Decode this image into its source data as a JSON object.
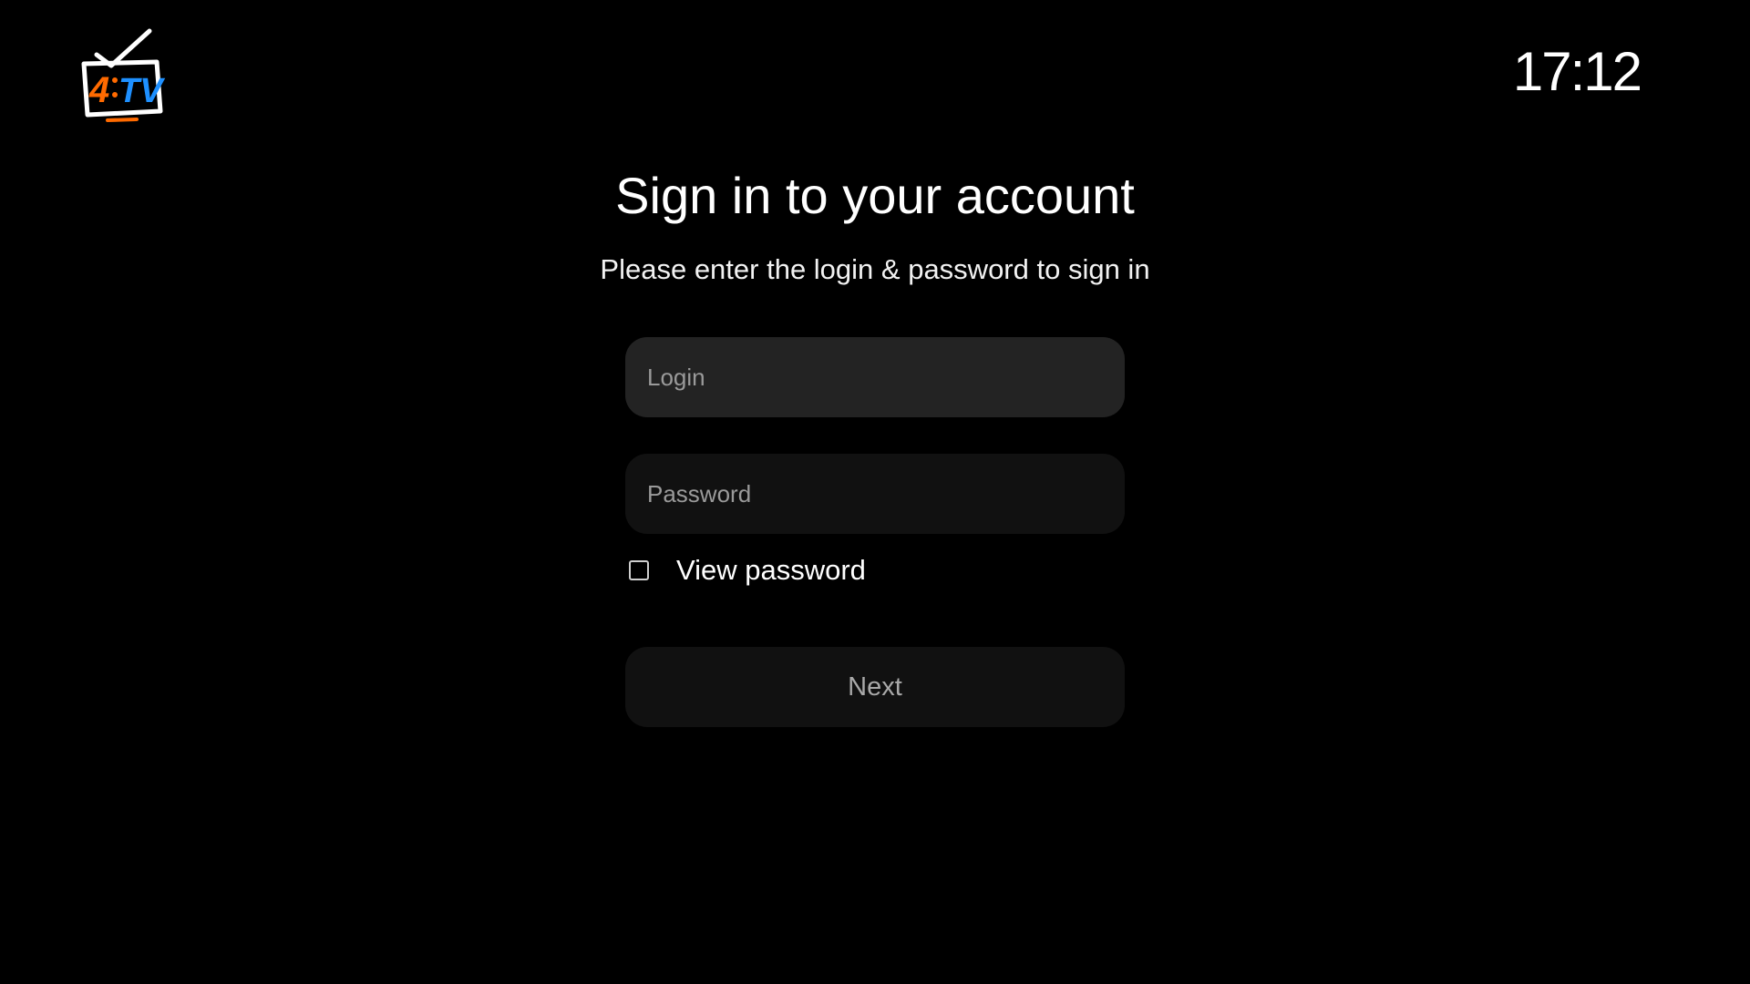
{
  "header": {
    "logo_icon": "tv-logo-icon",
    "clock": "17:12"
  },
  "signin": {
    "title": "Sign in to your account",
    "subtitle": "Please enter the login & password to sign in",
    "login": {
      "value": "",
      "placeholder": "Login"
    },
    "password": {
      "value": "",
      "placeholder": "Password"
    },
    "view_password": {
      "label": "View password",
      "checked": false
    },
    "next_label": "Next"
  },
  "colors": {
    "background": "#000000",
    "logo_orange": "#ff6a00",
    "logo_blue": "#1e90ff",
    "field_active": "#232323",
    "field_idle": "#111111",
    "placeholder": "#9a9a9a",
    "button_text_disabled": "#a9a9a9"
  }
}
